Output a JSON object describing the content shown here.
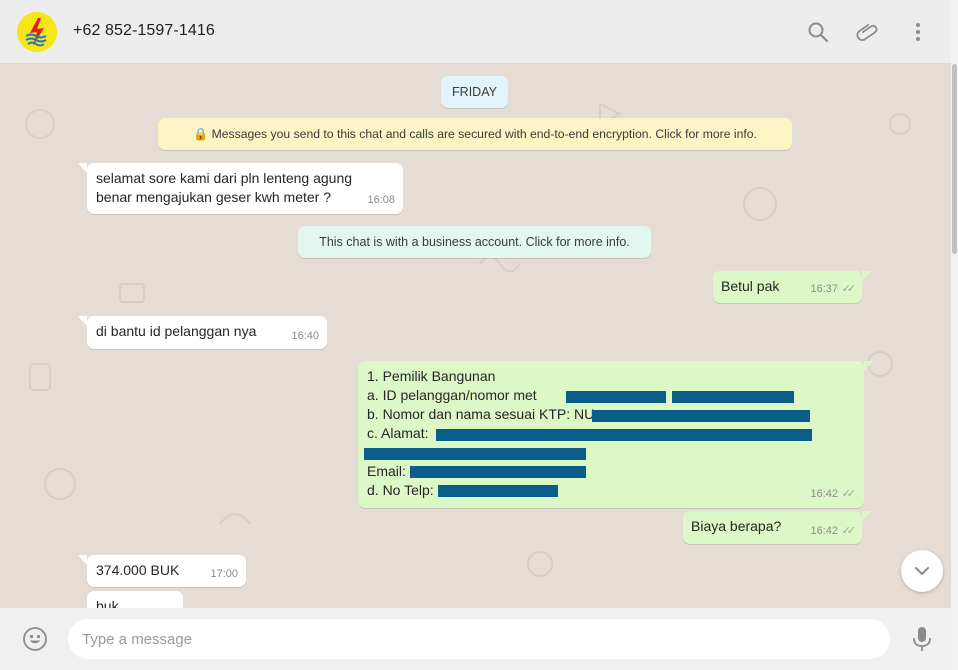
{
  "header": {
    "contact_name": "+62 852-1597-1416",
    "icons": [
      "pln-logo-icon",
      "search-icon",
      "paperclip-icon",
      "menu-dots-icon"
    ]
  },
  "chat": {
    "date_label": "FRIDAY",
    "encryption_notice": "🔒 Messages you send to this chat and calls are secured with end-to-end encryption. Click for more info.",
    "business_notice": "This chat is with a business account. Click for more info.",
    "messages": [
      {
        "direction": "in",
        "lines": [
          "selamat sore kami dari pln lenteng agung",
          "benar mengajukan geser kwh meter ?"
        ],
        "time": "16:08"
      },
      {
        "direction": "out",
        "lines": [
          "Betul pak"
        ],
        "time": "16:37",
        "status": "read"
      },
      {
        "direction": "in",
        "lines": [
          "di bantu id pelanggan nya"
        ],
        "time": "16:40"
      },
      {
        "direction": "out",
        "lines": [
          "1. Pemilik Bangunan",
          "a. ID pelanggan/nomor met",
          "b. Nomor dan nama sesuai KTP: NU",
          "c. Alamat:",
          "",
          "Email:",
          "d. No Telp:"
        ],
        "time": "16:42",
        "status": "read"
      },
      {
        "direction": "out",
        "lines": [
          "Biaya berapa?"
        ],
        "time": "16:42",
        "status": "read"
      },
      {
        "direction": "in",
        "lines": [
          "374.000 BUK"
        ],
        "time": "17:00"
      },
      {
        "direction": "in",
        "lines": [
          "buk"
        ],
        "time": ""
      }
    ]
  },
  "composer": {
    "placeholder": "Type a message",
    "value": "",
    "icons": [
      "emoji-icon",
      "microphone-icon"
    ]
  },
  "colors": {
    "incoming": "#ffffff",
    "outgoing": "#dcf8c6",
    "background": "#e5ddd5",
    "header": "#ededed",
    "redaction": "#0b5e8a"
  }
}
